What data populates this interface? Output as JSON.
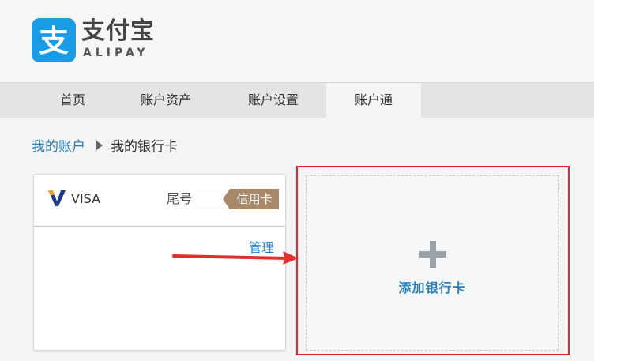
{
  "brand": {
    "name_cn": "支付宝",
    "name_en": "ALIPAY",
    "logo_char": "支",
    "color": "#1a9be6"
  },
  "nav": {
    "items": [
      {
        "label": "首页",
        "active": false
      },
      {
        "label": "账户资产",
        "active": false
      },
      {
        "label": "账户设置",
        "active": false
      },
      {
        "label": "账户通",
        "active": true
      }
    ]
  },
  "breadcrumb": {
    "parent": "我的账户",
    "current": "我的银行卡"
  },
  "card": {
    "network": "VISA",
    "tail_label": "尾号",
    "type_badge": "信用卡",
    "manage_label": "管理"
  },
  "add_card": {
    "label": "添加银行卡"
  },
  "colors": {
    "link": "#2b7fb8",
    "highlight": "#d9272e",
    "badge": "#a88a6a"
  }
}
